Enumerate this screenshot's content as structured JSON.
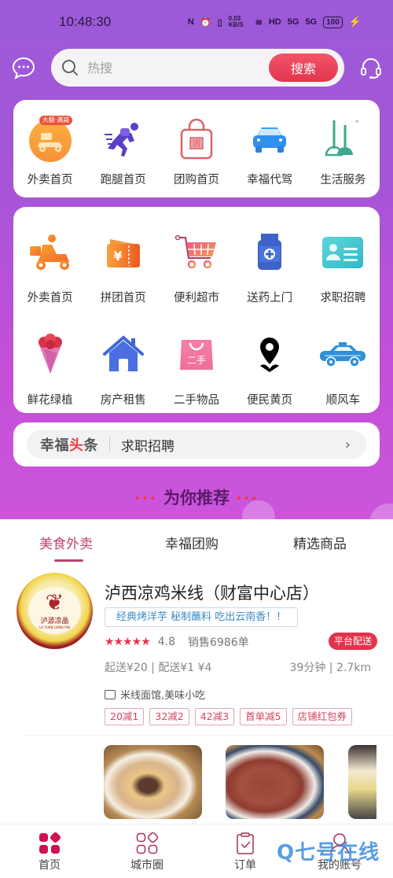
{
  "status_bar": {
    "time": "10:48:30",
    "network_speed": "0.03 KB/S",
    "signal_1": "5G",
    "signal_2": "5G",
    "hd_label": "HD",
    "battery": "100"
  },
  "header": {
    "search_placeholder": "热搜",
    "search_button": "搜索"
  },
  "quick_services": [
    {
      "label": "外卖首页",
      "icon": "scooter-icon",
      "badge": "大额·满减"
    },
    {
      "label": "跑腿首页",
      "icon": "runner-icon"
    },
    {
      "label": "团购首页",
      "icon": "shopping-bag-icon",
      "glyph": "团"
    },
    {
      "label": "幸福代驾",
      "icon": "car-icon"
    },
    {
      "label": "生活服务",
      "icon": "broom-icon"
    }
  ],
  "services": [
    {
      "label": "外卖首页",
      "icon": "delivery-rider-icon"
    },
    {
      "label": "拼团首页",
      "icon": "coupon-ticket-icon",
      "glyph": "¥"
    },
    {
      "label": "便利超市",
      "icon": "shopping-cart-icon"
    },
    {
      "label": "送药上门",
      "icon": "medicine-bottle-icon"
    },
    {
      "label": "求职招聘",
      "icon": "id-card-icon"
    },
    {
      "label": "鲜花绿植",
      "icon": "flower-bouquet-icon"
    },
    {
      "label": "房产租售",
      "icon": "house-icon"
    },
    {
      "label": "二手物品",
      "icon": "second-hand-bag-icon",
      "glyph": "二手"
    },
    {
      "label": "便民黄页",
      "icon": "location-pin-icon"
    },
    {
      "label": "顺风车",
      "icon": "taxi-icon"
    }
  ],
  "headline": {
    "logo_part1": "幸福",
    "logo_part2": "头",
    "logo_part3": "条",
    "text": "求职招聘"
  },
  "recommend": {
    "title": "为你推荐"
  },
  "tabs": [
    {
      "label": "美食外卖",
      "active": true
    },
    {
      "label": "幸福团购",
      "active": false
    },
    {
      "label": "精选商品",
      "active": false
    }
  ],
  "store": {
    "logo_text_cn": "泸源凉晶",
    "logo_text_en": "LU YUAN LIANG PIN",
    "name": "泸西凉鸡米线（财富中心店）",
    "slogan": "经典烤洋芋 秘制蘸料 吃出云南香！！",
    "stars": "★★★★★",
    "rating": "4.8",
    "sales": "销售6986单",
    "platform_badge": "平台配送",
    "delivery_info": "起送¥20 | 配送¥1  ¥4",
    "eta": "39分钟 | 2.7km",
    "category": "米线面馆,美味小吃",
    "promos": [
      "20减1",
      "32减2",
      "42减3",
      "首单减5",
      "店铺红包券"
    ]
  },
  "bottom_nav": [
    {
      "label": "首页",
      "icon": "home-grid-icon",
      "active": true
    },
    {
      "label": "城市圈",
      "icon": "city-circle-icon",
      "active": false
    },
    {
      "label": "订单",
      "icon": "order-clipboard-icon",
      "active": false
    },
    {
      "label": "我的账号",
      "icon": "user-account-icon",
      "active": false
    }
  ],
  "watermark": "Q七号在线",
  "colors": {
    "accent": "#e3344e",
    "tab_active": "#c0436a",
    "nav_active": "#d0124f",
    "hero_purple": "#a655d8"
  }
}
